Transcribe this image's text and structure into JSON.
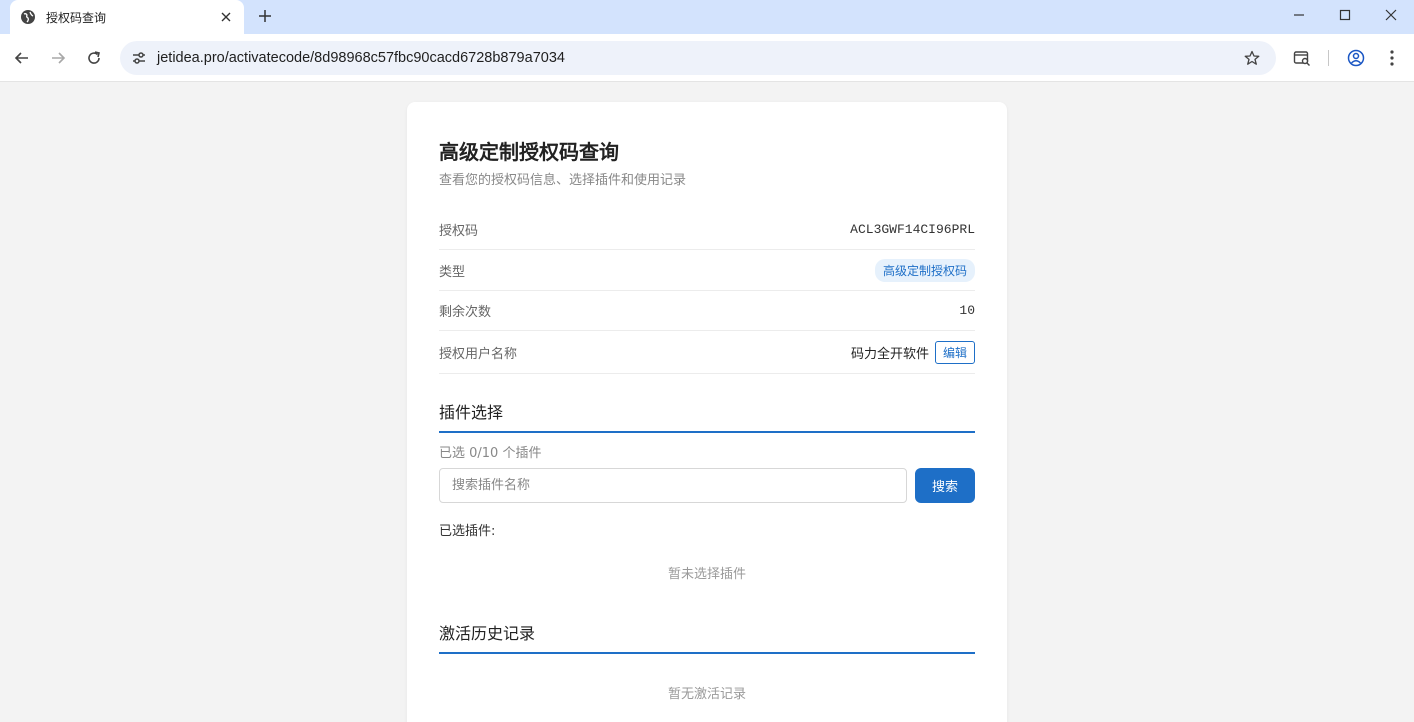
{
  "browser": {
    "tab_title": "授权码查询",
    "url": "jetidea.pro/activatecode/8d98968c57fbc90cacd6728b879a7034"
  },
  "page": {
    "title": "高级定制授权码查询",
    "subtitle": "查看您的授权码信息、选择插件和使用记录"
  },
  "info": {
    "code_label": "授权码",
    "code_value": "ACL3GWF14CI96PRL",
    "type_label": "类型",
    "type_value": "高级定制授权码",
    "remaining_label": "剩余次数",
    "remaining_value": "10",
    "user_label": "授权用户名称",
    "user_value": "码力全开软件",
    "edit_label": "编辑"
  },
  "plugins": {
    "section_title": "插件选择",
    "selected_count": "已选 0/10 个插件",
    "search_placeholder": "搜索插件名称",
    "search_button": "搜索",
    "selected_label": "已选插件:",
    "empty_text": "暂未选择插件"
  },
  "history": {
    "section_title": "激活历史记录",
    "empty_text": "暂无激活记录"
  },
  "colors": {
    "accent": "#1e6fc7",
    "tabbar": "#d3e3fd",
    "page_bg": "#f3f3f3"
  }
}
